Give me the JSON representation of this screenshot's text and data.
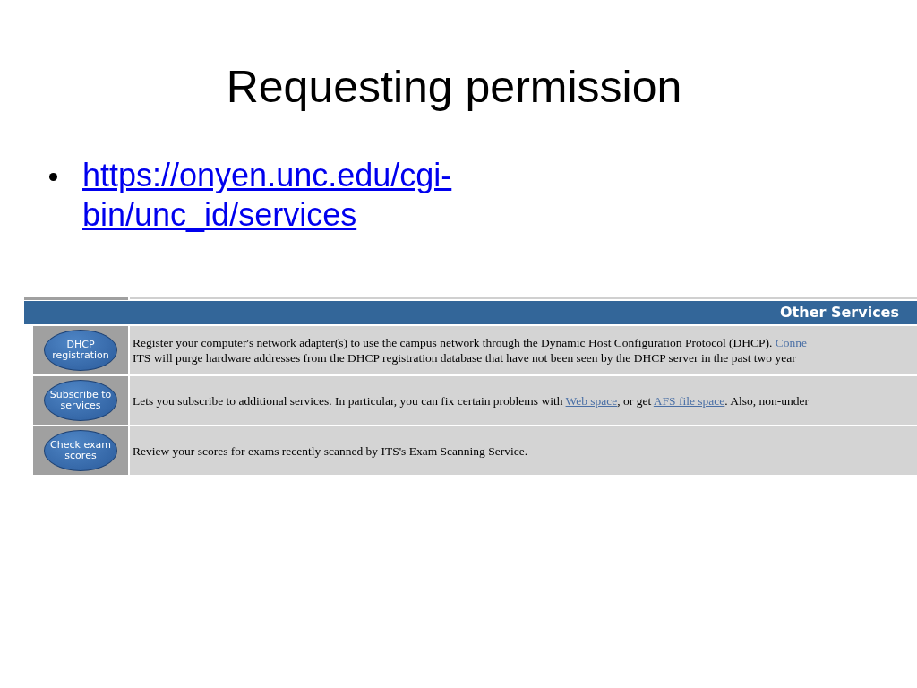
{
  "slide": {
    "title": "Requesting permission",
    "bullets": [
      {
        "kind": "link",
        "text": "https://onyen.unc.edu/cgi-bin/unc_id/services"
      }
    ]
  },
  "services_table": {
    "heading": "Other Services",
    "rows": [
      {
        "button": "DHCP registration",
        "lines": [
          [
            {
              "kind": "text",
              "text": "Register your computer's network adapter(s) to use the campus network through the Dynamic Host Configuration Protocol (DHCP). "
            },
            {
              "kind": "link",
              "text": "Conne"
            }
          ],
          [
            {
              "kind": "text",
              "text": "ITS will purge hardware addresses from the DHCP registration database that have not been seen by the DHCP server in the past two year"
            }
          ]
        ]
      },
      {
        "button": "Subscribe to services",
        "lines": [
          [
            {
              "kind": "text",
              "text": "Lets you subscribe to additional services. In particular, you can fix certain problems with "
            },
            {
              "kind": "link",
              "text": "Web space"
            },
            {
              "kind": "text",
              "text": ", or get "
            },
            {
              "kind": "link",
              "text": "AFS file space"
            },
            {
              "kind": "text",
              "text": ". Also, non-under"
            }
          ]
        ]
      },
      {
        "button": "Check exam scores",
        "lines": [
          [
            {
              "kind": "text",
              "text": "Review your scores for exams recently scanned by ITS's Exam Scanning Service."
            }
          ]
        ]
      }
    ]
  }
}
